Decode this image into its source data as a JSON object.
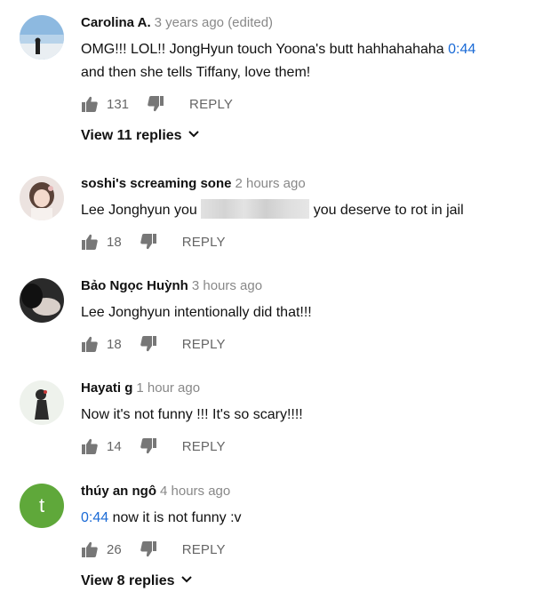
{
  "comments": [
    {
      "author": "Carolina A.",
      "time": "3 years ago (edited)",
      "text_line1": "OMG!!! LOL!! JongHyun touch Yoona's butt  hahhahahaha",
      "timestamp_link": "0:44",
      "text_line2": "and then she tells Tiffany, love them!",
      "likes": "131",
      "reply_label": "REPLY",
      "view_replies": "View 11 replies"
    },
    {
      "author": "soshi's screaming sone",
      "time": "2 hours ago",
      "text_before": "Lee Jonghyun you",
      "text_after": "you deserve to rot in jail",
      "likes": "18",
      "reply_label": "REPLY"
    },
    {
      "author": "Bảo Ngọc Huỳnh",
      "time": "3 hours ago",
      "text": "Lee Jonghyun intentionally did that!!!",
      "likes": "18",
      "reply_label": "REPLY"
    },
    {
      "author": "Hayati g",
      "time": "1 hour ago",
      "text": "Now it's not funny !!! It's so scary!!!!",
      "likes": "14",
      "reply_label": "REPLY"
    },
    {
      "author": "thúy an ngô",
      "time": "4 hours ago",
      "avatar_letter": "t",
      "timestamp_link": "0:44",
      "text": "now it is not funny :v",
      "likes": "26",
      "reply_label": "REPLY",
      "view_replies": "View 8 replies"
    }
  ],
  "colors": {
    "link": "#1a6ad6",
    "muted": "#888888",
    "action": "#666666",
    "letter_avatar": "#5fa83a"
  },
  "icons": {
    "like": "thumbs-up-icon",
    "dislike": "thumbs-down-icon",
    "expand": "chevron-down-icon"
  }
}
